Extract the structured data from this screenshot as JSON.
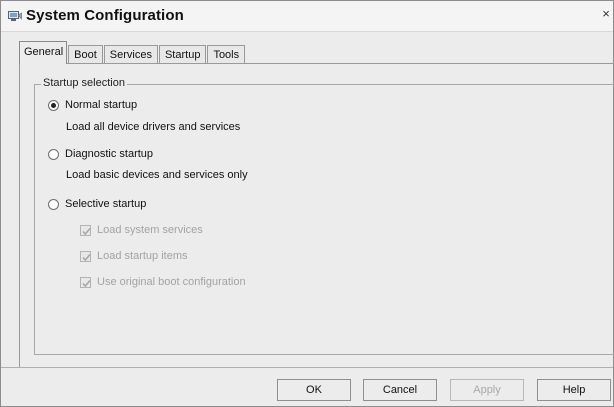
{
  "window": {
    "title": "System Configuration",
    "close_glyph": "×",
    "icon": "system-config-icon"
  },
  "tabs": [
    {
      "label": "General",
      "active": true
    },
    {
      "label": "Boot",
      "active": false
    },
    {
      "label": "Services",
      "active": false
    },
    {
      "label": "Startup",
      "active": false
    },
    {
      "label": "Tools",
      "active": false
    }
  ],
  "startup_selection": {
    "legend": "Startup selection",
    "options": [
      {
        "label": "Normal startup",
        "description": "Load all device drivers and services",
        "selected": true
      },
      {
        "label": "Diagnostic startup",
        "description": "Load basic devices and services only",
        "selected": false
      },
      {
        "label": "Selective startup",
        "selected": false
      }
    ],
    "selective_items": [
      {
        "label": "Load system services",
        "checked": true,
        "enabled": false
      },
      {
        "label": "Load startup items",
        "checked": true,
        "enabled": false
      },
      {
        "label": "Use original boot configuration",
        "checked": true,
        "enabled": false
      }
    ]
  },
  "buttons": {
    "ok": "OK",
    "cancel": "Cancel",
    "apply": "Apply",
    "help": "Help"
  }
}
